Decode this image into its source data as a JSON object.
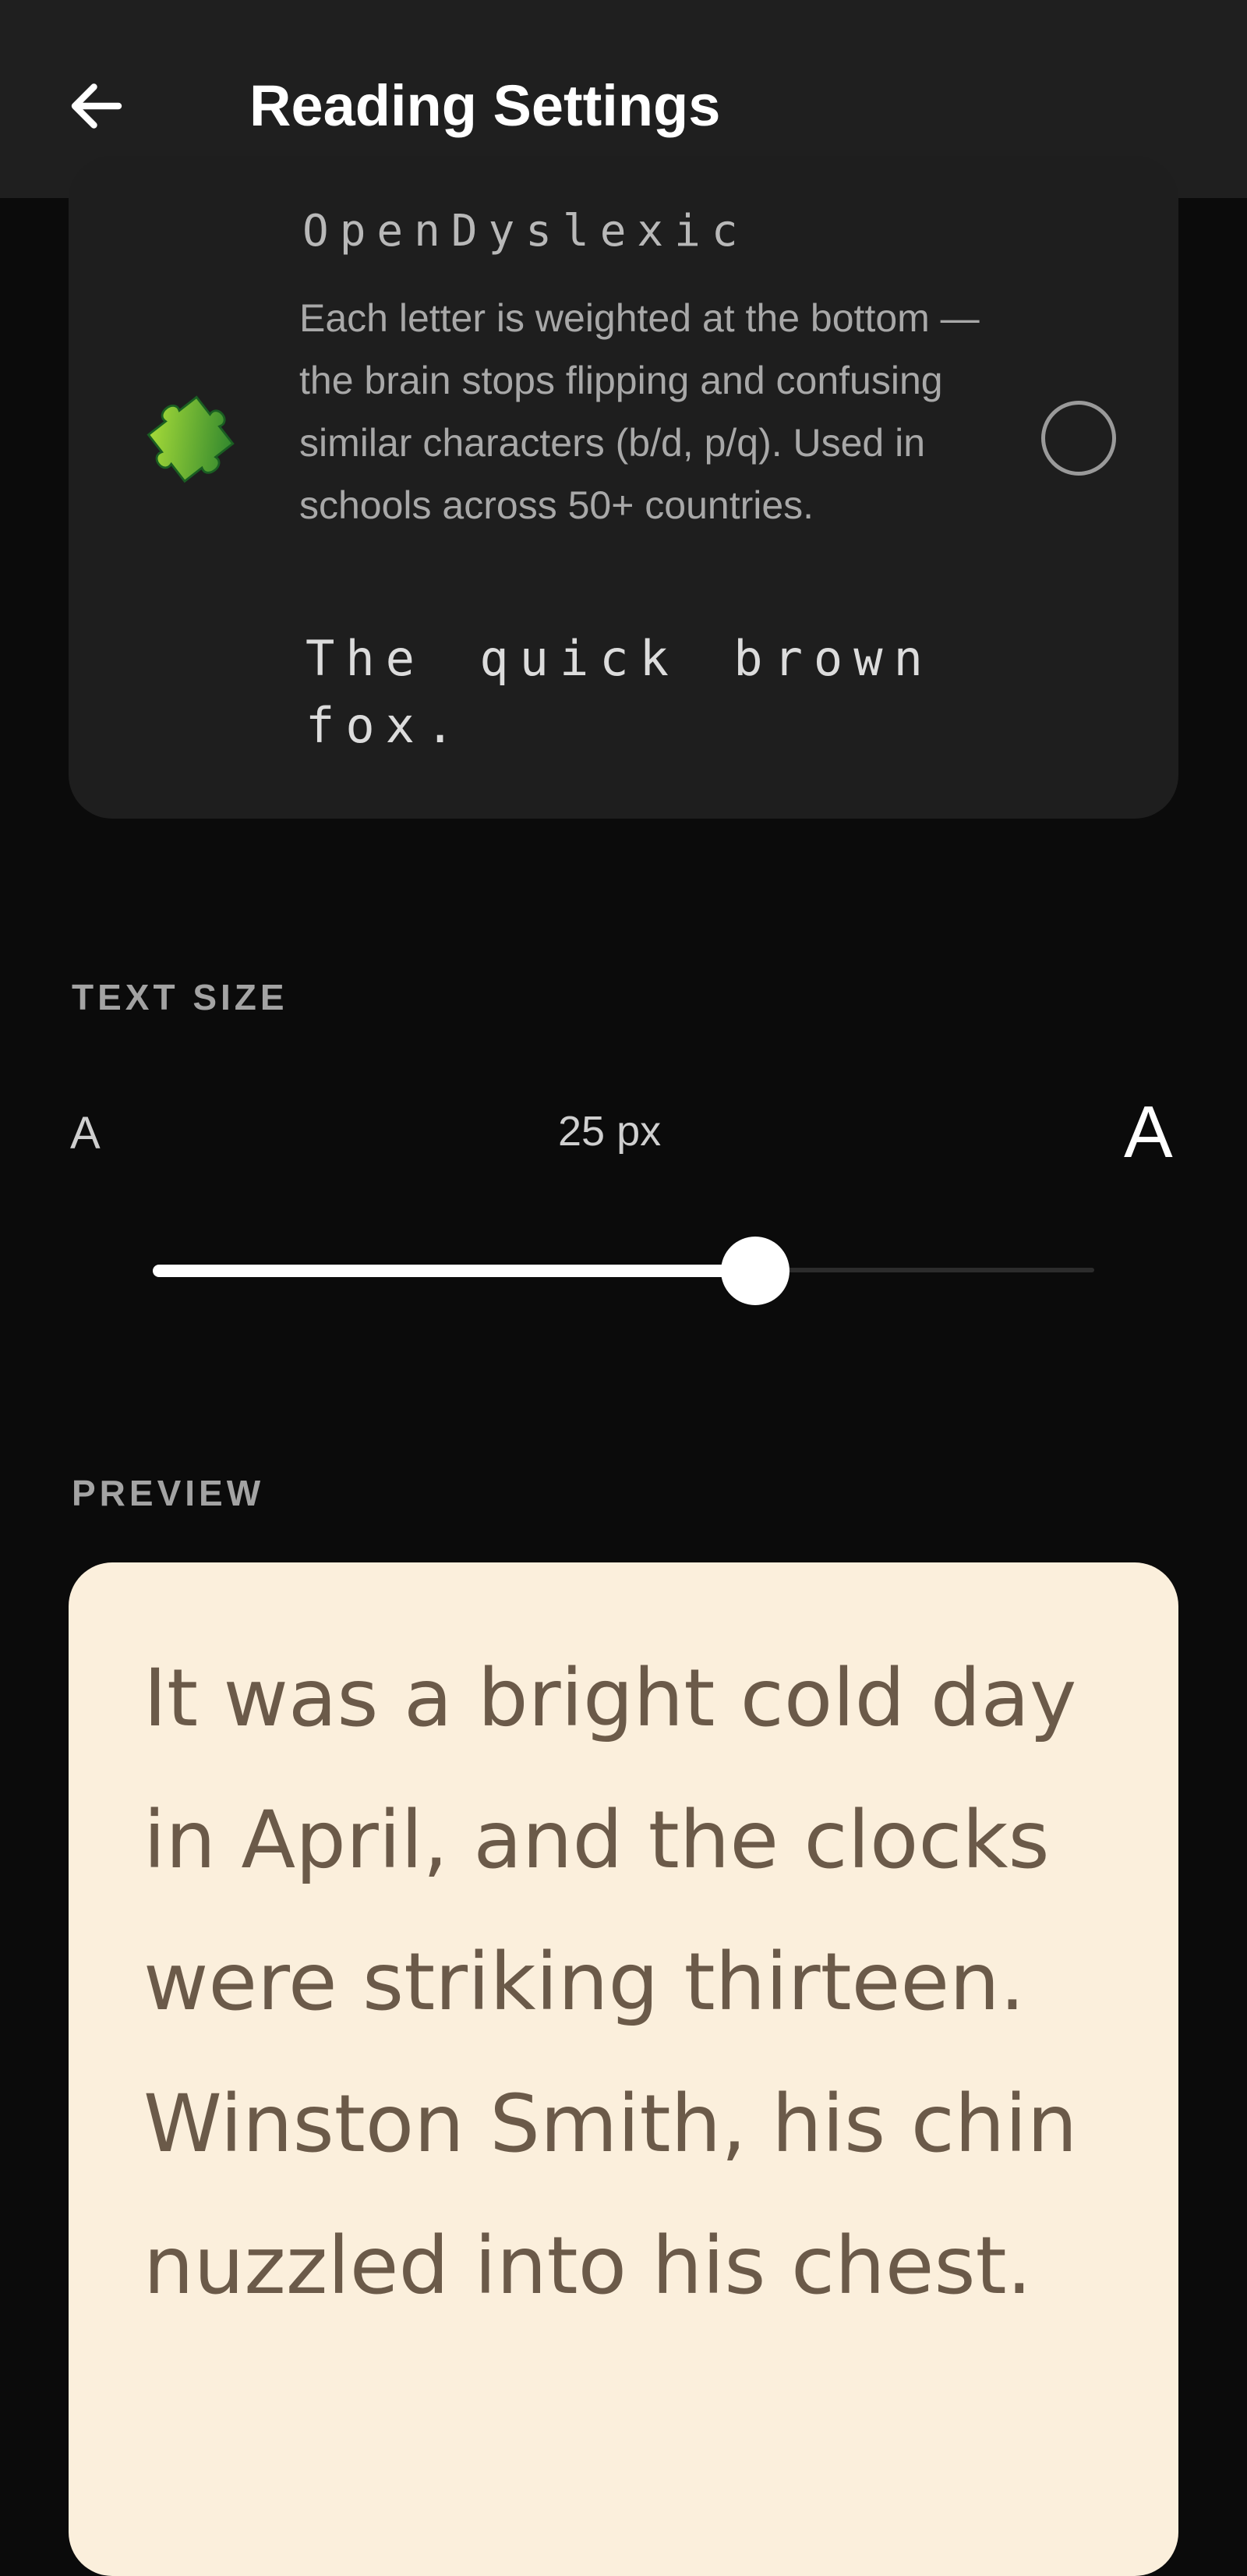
{
  "header": {
    "title": "Reading Settings",
    "back_icon": "arrow-left-icon"
  },
  "font_option": {
    "name": "OpenDyslexic",
    "description": "Each letter is weighted at the bottom — the brain stops flipping and confusing similar characters (b/d, p/q). Used in schools across 50+ countries.",
    "sample": "The quick brown fox.",
    "icon": "puzzle-piece-icon",
    "selected": false
  },
  "text_size": {
    "label": "TEXT SIZE",
    "small_marker": "A",
    "large_marker": "A",
    "value_label": "25 px",
    "slider_fraction": 0.64
  },
  "preview": {
    "label": "PREVIEW",
    "text": "It was a bright cold day in April, and the clocks were striking thirteen. Winston Smith, his chin nuzzled into his chest."
  },
  "colors": {
    "background": "#0b0b0b",
    "app_bar": "#1f1f1f",
    "card": "#1e1e1e",
    "preview_background": "#fbefdc",
    "preview_text": "#6b5a49",
    "puzzle_light": "#9ed82a",
    "puzzle_dark": "#2c8a2f"
  }
}
